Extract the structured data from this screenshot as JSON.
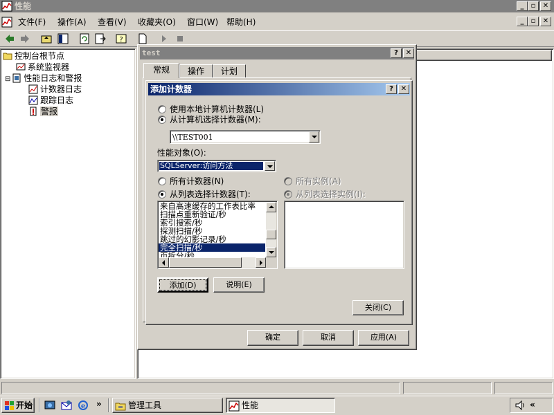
{
  "main_window": {
    "title": "性能",
    "caption_buttons": {
      "minimize": "_",
      "restore": "▫",
      "close": "✕"
    }
  },
  "menu": {
    "items": [
      "文件(F)",
      "操作(A)",
      "查看(V)",
      "收藏夹(O)",
      "窗口(W)",
      "帮助(H)"
    ]
  },
  "toolbar": {
    "icons": [
      "back-icon",
      "forward-icon",
      "up-folder-icon",
      "show-hide-tree-icon",
      "refresh-icon",
      "export-list-icon",
      "help-icon",
      "new-icon",
      "start-icon",
      "stop-icon"
    ]
  },
  "tree": {
    "items": [
      {
        "label": "控制台根节点",
        "icon": "folder-icon"
      },
      {
        "label": "系统监视器",
        "icon": "monitor-icon"
      },
      {
        "label": "性能日志和警报",
        "icon": "logs-icon",
        "expander": "⊟"
      },
      {
        "label": "计数器日志",
        "icon": "counter-log-icon"
      },
      {
        "label": "跟踪日志",
        "icon": "trace-log-icon"
      },
      {
        "label": "警报",
        "icon": "alert-icon"
      }
    ]
  },
  "test_dialog": {
    "title": "test",
    "help": "?",
    "close": "✕",
    "tabs": [
      "常规",
      "操作",
      "计划"
    ],
    "buttons": {
      "ok": "确定",
      "cancel": "取消",
      "apply": "应用(A)"
    }
  },
  "add_counter_dialog": {
    "title": "添加计数器",
    "help": "?",
    "close": "✕",
    "radio_local": "使用本地计算机计数器(L)",
    "radio_select_computer": "从计算机选择计数器(M):",
    "computer_value": "\\\\TEST001",
    "perf_object_label": "性能对象(O):",
    "perf_object_value": "SQLServer:访问方法",
    "radio_all_counters": "所有计数器(N)",
    "radio_select_counters": "从列表选择计数器(T):",
    "radio_all_instances": "所有实例(A)",
    "radio_select_instances": "从列表选择实例(I):",
    "counters": [
      "来自高速缓存的工作表比率",
      "扫描点重新验证/秒",
      "索引搜索/秒",
      "探测扫描/秒",
      "跳过的幻影记录/秒",
      "完全扫描/秒",
      "页拆分/秒"
    ],
    "selected_counter_index": 5,
    "add_button": "添加(D)",
    "explain_button": "说明(E)",
    "close_button": "关闭(C)"
  },
  "taskbar": {
    "start_label": "开始",
    "quick_launch_icons": [
      "show-desktop-icon",
      "outlook-express-icon",
      "ie-icon"
    ],
    "more": "»",
    "tasks": [
      {
        "label": "管理工具",
        "icon": "admin-tools-icon",
        "active": false
      },
      {
        "label": "性能",
        "icon": "perf-icon",
        "active": true
      }
    ],
    "tray_icons": [
      "volume-icon"
    ],
    "tray_more": "«"
  }
}
